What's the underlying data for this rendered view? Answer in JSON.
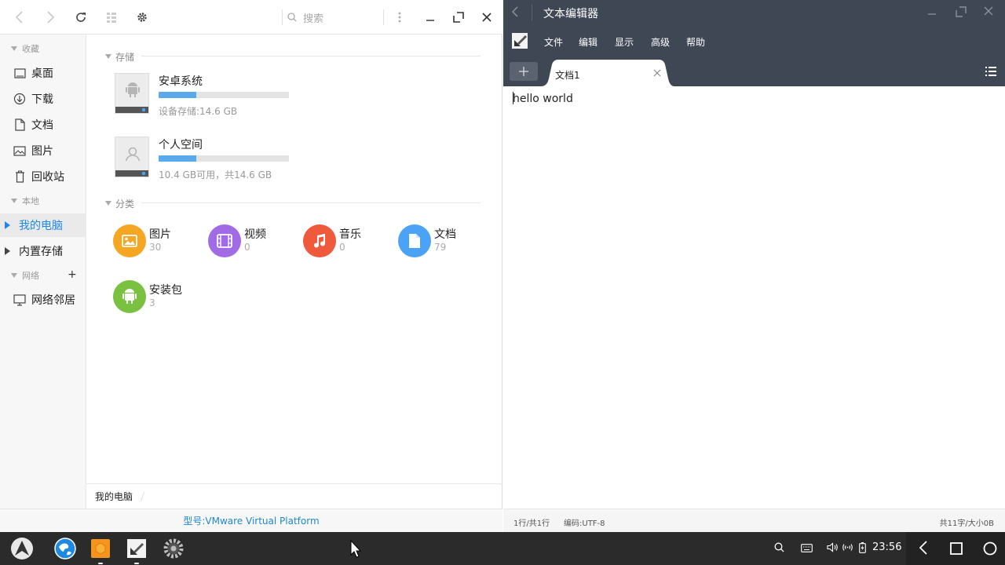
{
  "file_manager": {
    "search_placeholder": "搜索",
    "sidebar": {
      "favorites_header": "收藏",
      "favorites": [
        {
          "label": "桌面",
          "icon": "desktop-icon"
        },
        {
          "label": "下载",
          "icon": "download-icon"
        },
        {
          "label": "文档",
          "icon": "document-icon"
        },
        {
          "label": "图片",
          "icon": "picture-icon"
        },
        {
          "label": "回收站",
          "icon": "trash-icon"
        }
      ],
      "local_header": "本地",
      "local": [
        {
          "label": "我的电脑",
          "active": true
        },
        {
          "label": "内置存储",
          "active": false
        }
      ],
      "network_header": "网络",
      "network": [
        {
          "label": "网络邻居",
          "icon": "network-computer-icon"
        }
      ]
    },
    "storage": {
      "header": "存储",
      "drives": [
        {
          "name": "安卓系统",
          "info": "设备存储:14.6 GB",
          "used_fraction": 0.29,
          "icon": "android-icon"
        },
        {
          "name": "个人空间",
          "info": "10.4 GB可用，共14.6 GB",
          "used_fraction": 0.29,
          "icon": "user-icon"
        }
      ]
    },
    "categories": {
      "header": "分类",
      "items": [
        {
          "label": "图片",
          "count": "30",
          "color": "#f5a623",
          "icon": "image-icon"
        },
        {
          "label": "视频",
          "count": "0",
          "color": "#a26be6",
          "icon": "video-icon"
        },
        {
          "label": "音乐",
          "count": "0",
          "color": "#ef5a3c",
          "icon": "music-icon"
        },
        {
          "label": "文档",
          "count": "79",
          "color": "#4aa3f5",
          "icon": "doc-icon"
        },
        {
          "label": "安装包",
          "count": "3",
          "color": "#7ac142",
          "icon": "android-package-icon"
        }
      ]
    },
    "breadcrumb": "我的电脑",
    "status": "型号:VMware Virtual Platform"
  },
  "editor": {
    "title": "文本编辑器",
    "menu": [
      "文件",
      "编辑",
      "显示",
      "高级",
      "帮助"
    ],
    "tab_label": "文档1",
    "content": "hello world",
    "status_position": "1行/共1行",
    "status_encoding": "编码:UTF-8",
    "status_count": "共11字/大小0B"
  },
  "taskbar": {
    "clock": "23:56"
  },
  "colors": {
    "accent": "#1e88e5",
    "editor_chrome": "#404754",
    "taskbar": "#2b2b2b"
  }
}
